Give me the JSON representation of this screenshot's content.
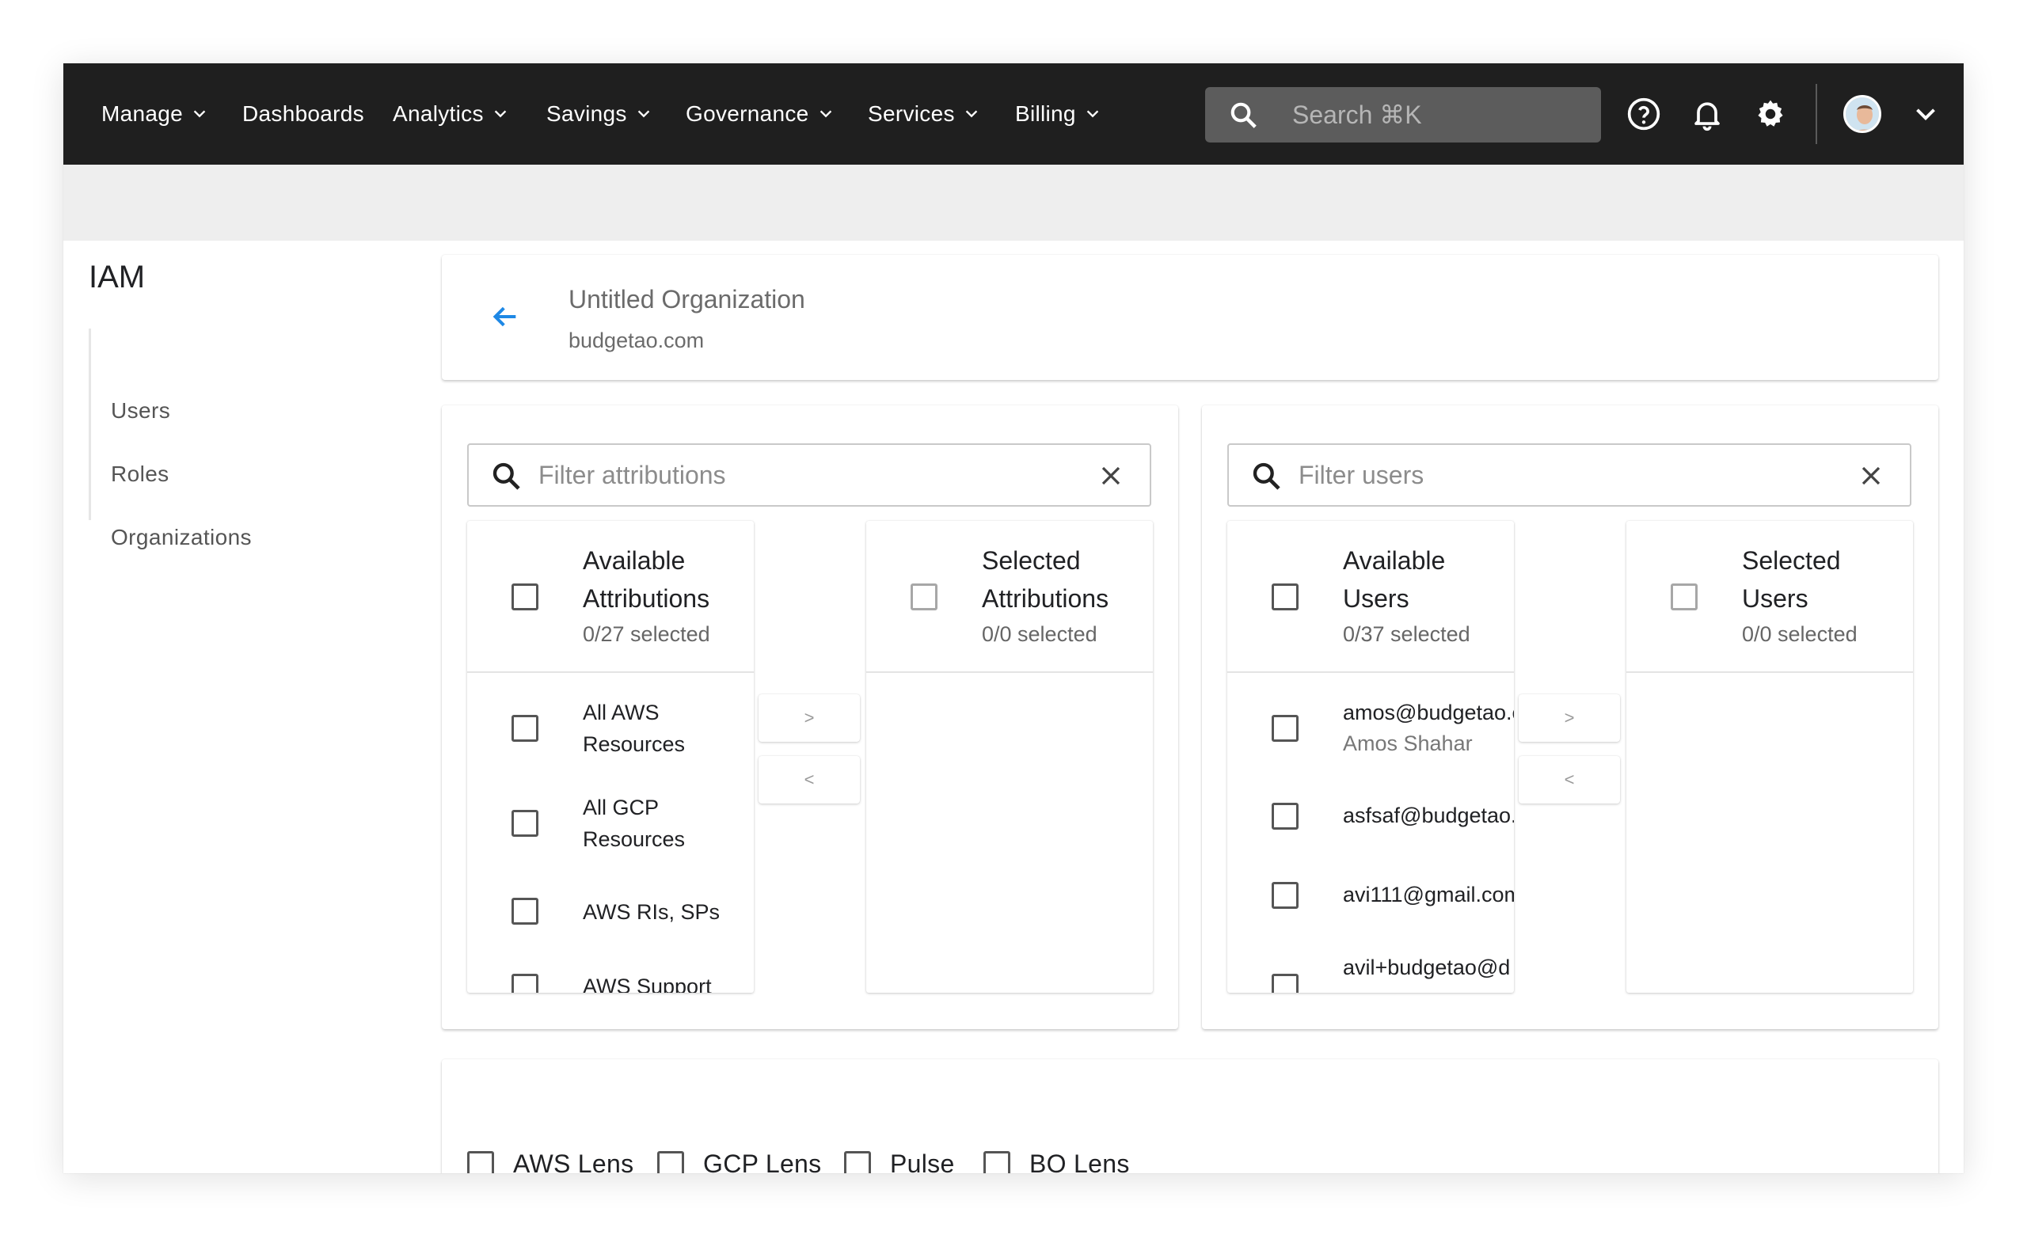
{
  "nav": {
    "items": [
      {
        "label": "Manage",
        "has_menu": true
      },
      {
        "label": "Dashboards",
        "has_menu": false
      },
      {
        "label": "Analytics",
        "has_menu": true
      },
      {
        "label": "Savings",
        "has_menu": true
      },
      {
        "label": "Governance",
        "has_menu": true
      },
      {
        "label": "Services",
        "has_menu": true
      },
      {
        "label": "Billing",
        "has_menu": true
      }
    ],
    "search_placeholder": "Search ⌘K",
    "icons": [
      "help-icon",
      "bell-icon",
      "gear-icon",
      "avatar",
      "chevron-down-icon"
    ]
  },
  "sidebar": {
    "title": "IAM",
    "items": [
      {
        "label": "Users"
      },
      {
        "label": "Roles"
      },
      {
        "label": "Organizations"
      }
    ]
  },
  "header": {
    "org_name": "Untitled Organization",
    "domain": "budgetao.com"
  },
  "attributions": {
    "filter_placeholder": "Filter attributions",
    "available": {
      "title": "Available Attributions",
      "count": "0/27 selected",
      "items": [
        {
          "label": "All AWS Resources"
        },
        {
          "label": "All GCP Resources"
        },
        {
          "label": "AWS RIs, SPs"
        },
        {
          "label": "AWS Support"
        }
      ]
    },
    "selected": {
      "title": "Selected Attributions",
      "count": "0/0 selected"
    },
    "move_right": ">",
    "move_left": "<"
  },
  "users": {
    "filter_placeholder": "Filter users",
    "available": {
      "title": "Available Users",
      "count": "0/37 selected",
      "items": [
        {
          "email": "amos@budgetao.com",
          "name": "Amos Shahar"
        },
        {
          "email": "asfsaf@budgetao.com",
          "name": ""
        },
        {
          "email": "avi111@gmail.com",
          "name": ""
        },
        {
          "email": "avil+budgetao@d",
          "name": ""
        }
      ]
    },
    "selected": {
      "title": "Selected Users",
      "count": "0/0 selected"
    },
    "move_right": ">",
    "move_left": "<"
  },
  "lenses": [
    {
      "label": "AWS Lens"
    },
    {
      "label": "GCP Lens"
    },
    {
      "label": "Pulse"
    },
    {
      "label": "BO Lens"
    }
  ],
  "colors": {
    "topbar": "#1f1f1f",
    "accent": "#1e88e5",
    "band": "#eeeeee"
  }
}
